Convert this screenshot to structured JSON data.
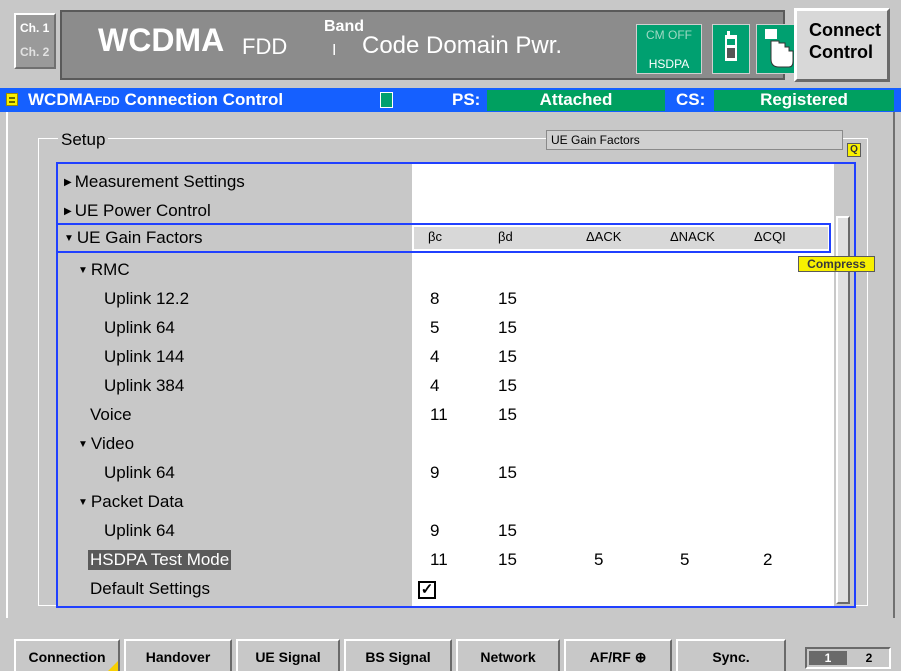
{
  "titlebar": {
    "ch1": "Ch. 1",
    "ch2": "Ch. 2",
    "main_title": "WCDMA",
    "fdd": "FDD",
    "band_label": "Band",
    "band_value": "I",
    "app_name": "Code Domain Pwr.",
    "cm_off": "CM OFF",
    "hsdpa": "HSDPA",
    "connect_control": "Connect Control"
  },
  "statusbar": {
    "title": "WCDMA",
    "fdd": "FDD",
    "suffix": "Connection Control",
    "ps_label": "PS:",
    "ps_value": "Attached",
    "cs_label": "CS:",
    "cs_value": "Registered"
  },
  "setup": {
    "label": "Setup",
    "page_title": "UE Gain Factors",
    "compress": "Compress"
  },
  "columns": [
    "βc",
    "βd",
    "ΔACK",
    "ΔNACK",
    "ΔCQI"
  ],
  "rows": [
    {
      "label": "Measurement Settings"
    },
    {
      "label": "UE Power Control"
    },
    {
      "label": "UE Gain Factors"
    },
    {
      "label": "RMC"
    },
    {
      "label": "Uplink  12.2",
      "bc": "8",
      "bd": "15"
    },
    {
      "label": "Uplink  64",
      "bc": "5",
      "bd": "15"
    },
    {
      "label": "Uplink 144",
      "bc": "4",
      "bd": "15"
    },
    {
      "label": "Uplink 384",
      "bc": "4",
      "bd": "15"
    },
    {
      "label": "Voice",
      "bc": "11",
      "bd": "15"
    },
    {
      "label": "Video"
    },
    {
      "label": "Uplink  64",
      "bc": "9",
      "bd": "15"
    },
    {
      "label": "Packet Data"
    },
    {
      "label": "Uplink  64",
      "bc": "9",
      "bd": "15"
    },
    {
      "label": "HSDPA Test Mode",
      "bc": "11",
      "bd": "15",
      "ack": "5",
      "nack": "5",
      "cqi": "2"
    },
    {
      "label": "Default Settings",
      "check": "✓"
    }
  ],
  "softkeys": [
    "Connection",
    "Handover",
    "UE Signal",
    "BS Signal",
    "Network",
    "AF/RF",
    "Sync."
  ],
  "afrf_icon": "⊕",
  "pages": [
    "1",
    "2"
  ],
  "colors": {
    "accent_blue": "#1560ff",
    "status_green": "#00a060",
    "highlight_yellow": "#f8f000"
  }
}
